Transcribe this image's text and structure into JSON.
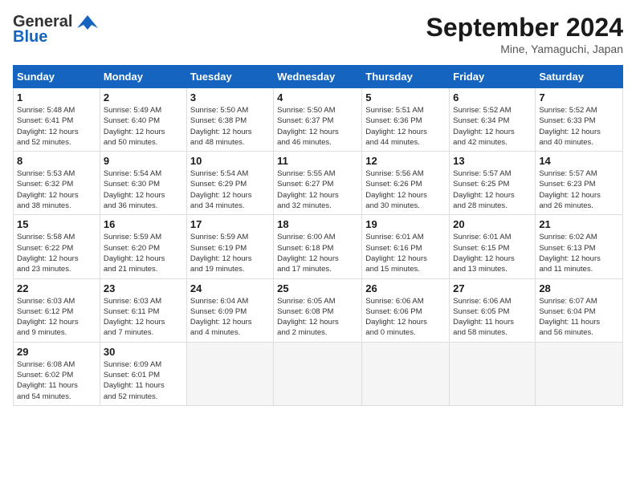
{
  "header": {
    "logo_line1": "General",
    "logo_line2": "Blue",
    "month": "September 2024",
    "location": "Mine, Yamaguchi, Japan"
  },
  "days_of_week": [
    "Sunday",
    "Monday",
    "Tuesday",
    "Wednesday",
    "Thursday",
    "Friday",
    "Saturday"
  ],
  "weeks": [
    [
      {
        "day": "1",
        "sunrise": "5:48 AM",
        "sunset": "6:41 PM",
        "daylight": "12 hours and 52 minutes."
      },
      {
        "day": "2",
        "sunrise": "5:49 AM",
        "sunset": "6:40 PM",
        "daylight": "12 hours and 50 minutes."
      },
      {
        "day": "3",
        "sunrise": "5:50 AM",
        "sunset": "6:38 PM",
        "daylight": "12 hours and 48 minutes."
      },
      {
        "day": "4",
        "sunrise": "5:50 AM",
        "sunset": "6:37 PM",
        "daylight": "12 hours and 46 minutes."
      },
      {
        "day": "5",
        "sunrise": "5:51 AM",
        "sunset": "6:36 PM",
        "daylight": "12 hours and 44 minutes."
      },
      {
        "day": "6",
        "sunrise": "5:52 AM",
        "sunset": "6:34 PM",
        "daylight": "12 hours and 42 minutes."
      },
      {
        "day": "7",
        "sunrise": "5:52 AM",
        "sunset": "6:33 PM",
        "daylight": "12 hours and 40 minutes."
      }
    ],
    [
      {
        "day": "8",
        "sunrise": "5:53 AM",
        "sunset": "6:32 PM",
        "daylight": "12 hours and 38 minutes."
      },
      {
        "day": "9",
        "sunrise": "5:54 AM",
        "sunset": "6:30 PM",
        "daylight": "12 hours and 36 minutes."
      },
      {
        "day": "10",
        "sunrise": "5:54 AM",
        "sunset": "6:29 PM",
        "daylight": "12 hours and 34 minutes."
      },
      {
        "day": "11",
        "sunrise": "5:55 AM",
        "sunset": "6:27 PM",
        "daylight": "12 hours and 32 minutes."
      },
      {
        "day": "12",
        "sunrise": "5:56 AM",
        "sunset": "6:26 PM",
        "daylight": "12 hours and 30 minutes."
      },
      {
        "day": "13",
        "sunrise": "5:57 AM",
        "sunset": "6:25 PM",
        "daylight": "12 hours and 28 minutes."
      },
      {
        "day": "14",
        "sunrise": "5:57 AM",
        "sunset": "6:23 PM",
        "daylight": "12 hours and 26 minutes."
      }
    ],
    [
      {
        "day": "15",
        "sunrise": "5:58 AM",
        "sunset": "6:22 PM",
        "daylight": "12 hours and 23 minutes."
      },
      {
        "day": "16",
        "sunrise": "5:59 AM",
        "sunset": "6:20 PM",
        "daylight": "12 hours and 21 minutes."
      },
      {
        "day": "17",
        "sunrise": "5:59 AM",
        "sunset": "6:19 PM",
        "daylight": "12 hours and 19 minutes."
      },
      {
        "day": "18",
        "sunrise": "6:00 AM",
        "sunset": "6:18 PM",
        "daylight": "12 hours and 17 minutes."
      },
      {
        "day": "19",
        "sunrise": "6:01 AM",
        "sunset": "6:16 PM",
        "daylight": "12 hours and 15 minutes."
      },
      {
        "day": "20",
        "sunrise": "6:01 AM",
        "sunset": "6:15 PM",
        "daylight": "12 hours and 13 minutes."
      },
      {
        "day": "21",
        "sunrise": "6:02 AM",
        "sunset": "6:13 PM",
        "daylight": "12 hours and 11 minutes."
      }
    ],
    [
      {
        "day": "22",
        "sunrise": "6:03 AM",
        "sunset": "6:12 PM",
        "daylight": "12 hours and 9 minutes."
      },
      {
        "day": "23",
        "sunrise": "6:03 AM",
        "sunset": "6:11 PM",
        "daylight": "12 hours and 7 minutes."
      },
      {
        "day": "24",
        "sunrise": "6:04 AM",
        "sunset": "6:09 PM",
        "daylight": "12 hours and 4 minutes."
      },
      {
        "day": "25",
        "sunrise": "6:05 AM",
        "sunset": "6:08 PM",
        "daylight": "12 hours and 2 minutes."
      },
      {
        "day": "26",
        "sunrise": "6:06 AM",
        "sunset": "6:06 PM",
        "daylight": "12 hours and 0 minutes."
      },
      {
        "day": "27",
        "sunrise": "6:06 AM",
        "sunset": "6:05 PM",
        "daylight": "11 hours and 58 minutes."
      },
      {
        "day": "28",
        "sunrise": "6:07 AM",
        "sunset": "6:04 PM",
        "daylight": "11 hours and 56 minutes."
      }
    ],
    [
      {
        "day": "29",
        "sunrise": "6:08 AM",
        "sunset": "6:02 PM",
        "daylight": "11 hours and 54 minutes."
      },
      {
        "day": "30",
        "sunrise": "6:09 AM",
        "sunset": "6:01 PM",
        "daylight": "11 hours and 52 minutes."
      },
      null,
      null,
      null,
      null,
      null
    ]
  ]
}
